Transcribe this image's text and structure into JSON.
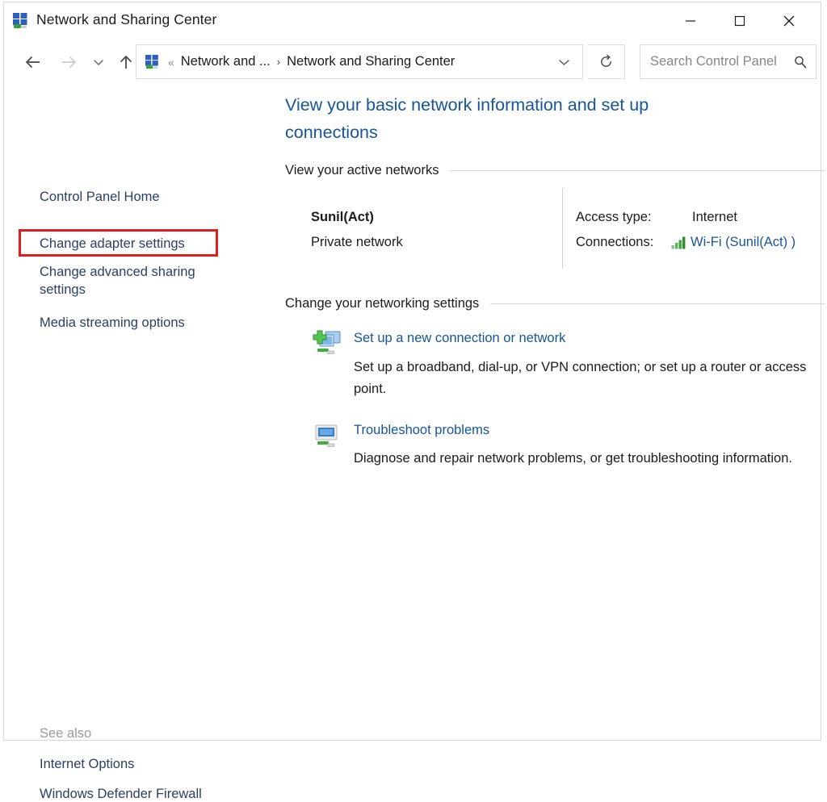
{
  "window": {
    "title": "Network and Sharing Center",
    "icon": "network-icon",
    "controls": {
      "minimize": "minimize-icon",
      "maximize": "maximize-icon",
      "close": "close-icon"
    }
  },
  "toolbar": {
    "back": "back-arrow-icon",
    "forward": "forward-arrow-icon",
    "recent": "chevron-down-icon",
    "up": "up-arrow-icon",
    "refresh": "refresh-icon",
    "breadcrumb": {
      "icon": "network-icon",
      "overflow": "«",
      "items": [
        "Network and ...",
        "Network and Sharing Center"
      ],
      "separator": "›",
      "dropdown": "chevron-down-icon"
    },
    "search": {
      "placeholder": "Search Control Panel",
      "value": "",
      "icon": "search-icon"
    }
  },
  "sidebar": {
    "items": [
      {
        "label": "Control Panel Home"
      },
      {
        "label": "Change adapter settings"
      },
      {
        "label": "Change advanced sharing settings"
      },
      {
        "label": "Media streaming options"
      }
    ],
    "highlight": {
      "target": "Change adapter settings",
      "color": "#e01e1e"
    },
    "see_also": {
      "label": "See also",
      "items": [
        {
          "label": "Internet Options"
        },
        {
          "label": "Windows Defender Firewall"
        }
      ]
    }
  },
  "main": {
    "heading": "View your basic network information and set up connections",
    "active_networks": {
      "section_title": "View your active networks",
      "network_name": "Sunil(Act)",
      "network_type": "Private network",
      "access_type_label": "Access type:",
      "access_type_value": "Internet",
      "connections_label": "Connections:",
      "connections_value": "Wi-Fi (Sunil(Act) )",
      "signal_icon": "wifi-signal-bars-icon"
    },
    "networking_settings": {
      "section_title": "Change your networking settings",
      "tasks": [
        {
          "icon": "new-connection-icon",
          "link": "Set up a new connection or network",
          "description": "Set up a broadband, dial-up, or VPN connection; or set up a router or access point."
        },
        {
          "icon": "troubleshoot-icon",
          "link": "Troubleshoot problems",
          "description": "Diagnose and repair network problems, or get troubleshooting information."
        }
      ]
    }
  },
  "colors": {
    "link": "#16559a",
    "sidebar_link": "#2c3e66",
    "highlight": "#e01e1e",
    "signal_green": "#3a9d3a"
  }
}
